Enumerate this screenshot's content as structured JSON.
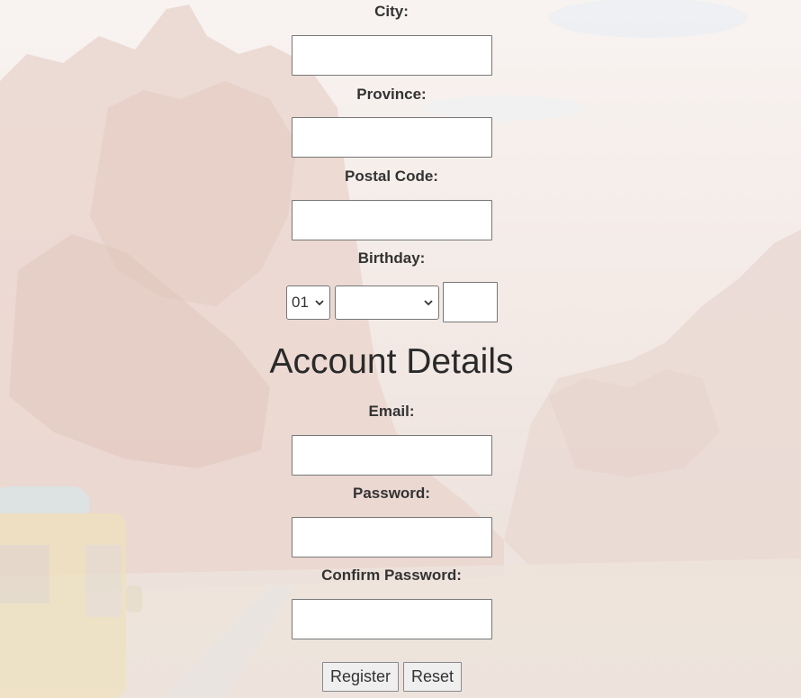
{
  "address": {
    "city_label": "City:",
    "province_label": "Province:",
    "postal_label": "Postal Code:"
  },
  "birthday": {
    "label": "Birthday:",
    "day_value": "01",
    "month_value": "",
    "year_value": ""
  },
  "account": {
    "heading": "Account Details",
    "email_label": "Email:",
    "password_label": "Password:",
    "confirm_label": "Confirm Password:"
  },
  "buttons": {
    "register_label": "Register",
    "reset_label": "Reset"
  },
  "colors": {
    "background": "#f4ebe7",
    "field_border": "#777777",
    "button_bg": "#efefef"
  }
}
